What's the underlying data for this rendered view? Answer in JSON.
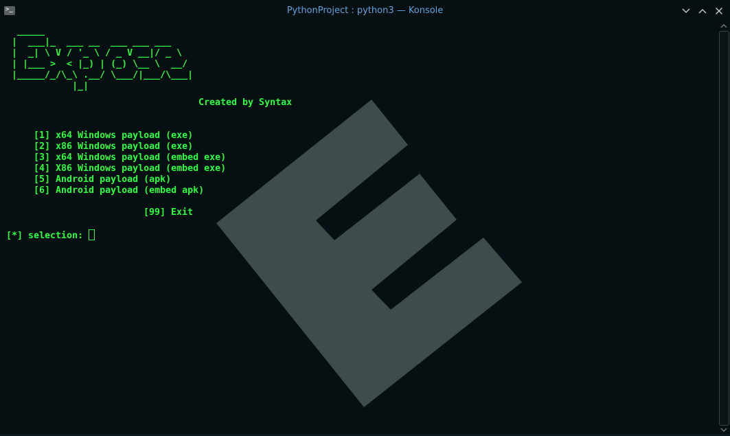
{
  "window": {
    "title": "PythonProject : python3 — Konsole",
    "app_icon_glyph": ">_"
  },
  "terminal": {
    "logo": [
      "  _____",
      " |  ___|_  ___ __  ___ ___ ___",
      " |  _| \\ V / '_ \\ / _ V __|/ _ \\",
      " | |___ >  < |_) | (_) \\__ \\  __/",
      " |_____/_/\\_\\ .__/ \\___/|___/\\___|",
      "            |_|"
    ],
    "credit": "Created by Syntax",
    "menu": [
      "[1] x64 Windows payload (exe)",
      "[2] x86 Windows payload (exe)",
      "[3] x64 Windows payload (embed exe)",
      "[4] X86 Windows payload (embed exe)",
      "[5] Android payload (apk)",
      "[6] Android payload (embed apk)"
    ],
    "exit_option": "[99] Exit",
    "prompt": "[*] selection: "
  },
  "colors": {
    "background": "#061013",
    "text": "#2dfd3e",
    "title": "#61a2dc",
    "watermark": "#3e4c4c"
  },
  "icons": {
    "app": "terminal-app-icon",
    "minimize": "chevron-down-icon",
    "maximize": "chevron-up-icon",
    "close": "close-icon"
  }
}
